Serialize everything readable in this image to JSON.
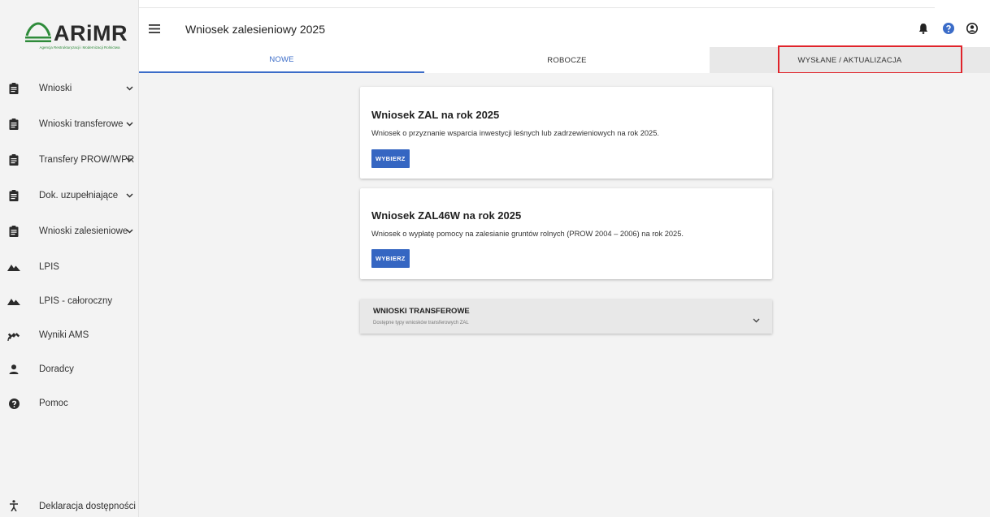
{
  "logo": {
    "text": "ARiMR",
    "subtitle": "Agencja Restrukturyzacji i Modernizacji Rolnictwa"
  },
  "header": {
    "title": "Wniosek zalesieniowy 2025",
    "icons": [
      "bell-icon",
      "help-icon",
      "account-icon"
    ]
  },
  "sidebar": {
    "items": [
      {
        "label": "Wnioski",
        "icon": "clipboard-icon",
        "has_chevron": true
      },
      {
        "label": "Wnioski transferowe",
        "icon": "clipboard-icon",
        "has_chevron": true
      },
      {
        "label": "Transfery PROW/WPR",
        "icon": "clipboard-icon",
        "has_chevron": true
      },
      {
        "label": "Dok. uzupełniające",
        "icon": "clipboard-icon",
        "has_chevron": true
      },
      {
        "label": "Wnioski zalesieniowe",
        "icon": "clipboard-icon",
        "has_chevron": true
      },
      {
        "label": "LPIS",
        "icon": "terrain-icon",
        "has_chevron": false
      },
      {
        "label": "LPIS - całoroczny",
        "icon": "terrain-icon",
        "has_chevron": false
      },
      {
        "label": "Wyniki AMS",
        "icon": "satellite-icon",
        "has_chevron": false
      },
      {
        "label": "Doradcy",
        "icon": "person-icon",
        "has_chevron": false
      },
      {
        "label": "Pomoc",
        "icon": "help-icon",
        "has_chevron": false
      }
    ],
    "footer_label": "Deklaracja dostępności"
  },
  "tabs": [
    {
      "label": "NOWE",
      "active": true
    },
    {
      "label": "ROBOCZE",
      "active": false
    },
    {
      "label": "WYSŁANE / AKTUALIZACJA",
      "active": false,
      "highlighted": true
    }
  ],
  "cards": [
    {
      "title": "Wniosek ZAL na rok 2025",
      "description": "Wniosek o przyznanie wsparcia inwestycji leśnych lub zadrzewieniowych na rok 2025.",
      "button": "WYBIERZ"
    },
    {
      "title": "Wniosek ZAL46W na rok 2025",
      "description": "Wniosek o wypłatę pomocy na zalesianie gruntów rolnych (PROW 2004 – 2006) na rok 2025.",
      "button": "WYBIERZ"
    }
  ],
  "expander": {
    "title": "WNIOSKI TRANSFEROWE",
    "subtitle": "Dostępne typy wniosków transferowych ZAL"
  },
  "colors": {
    "accent": "#3566c2",
    "tab_active": "#3b6cc8",
    "highlight": "#e0232a",
    "logo_green": "#2e8b3a",
    "help_blue": "#3b6cc8"
  }
}
